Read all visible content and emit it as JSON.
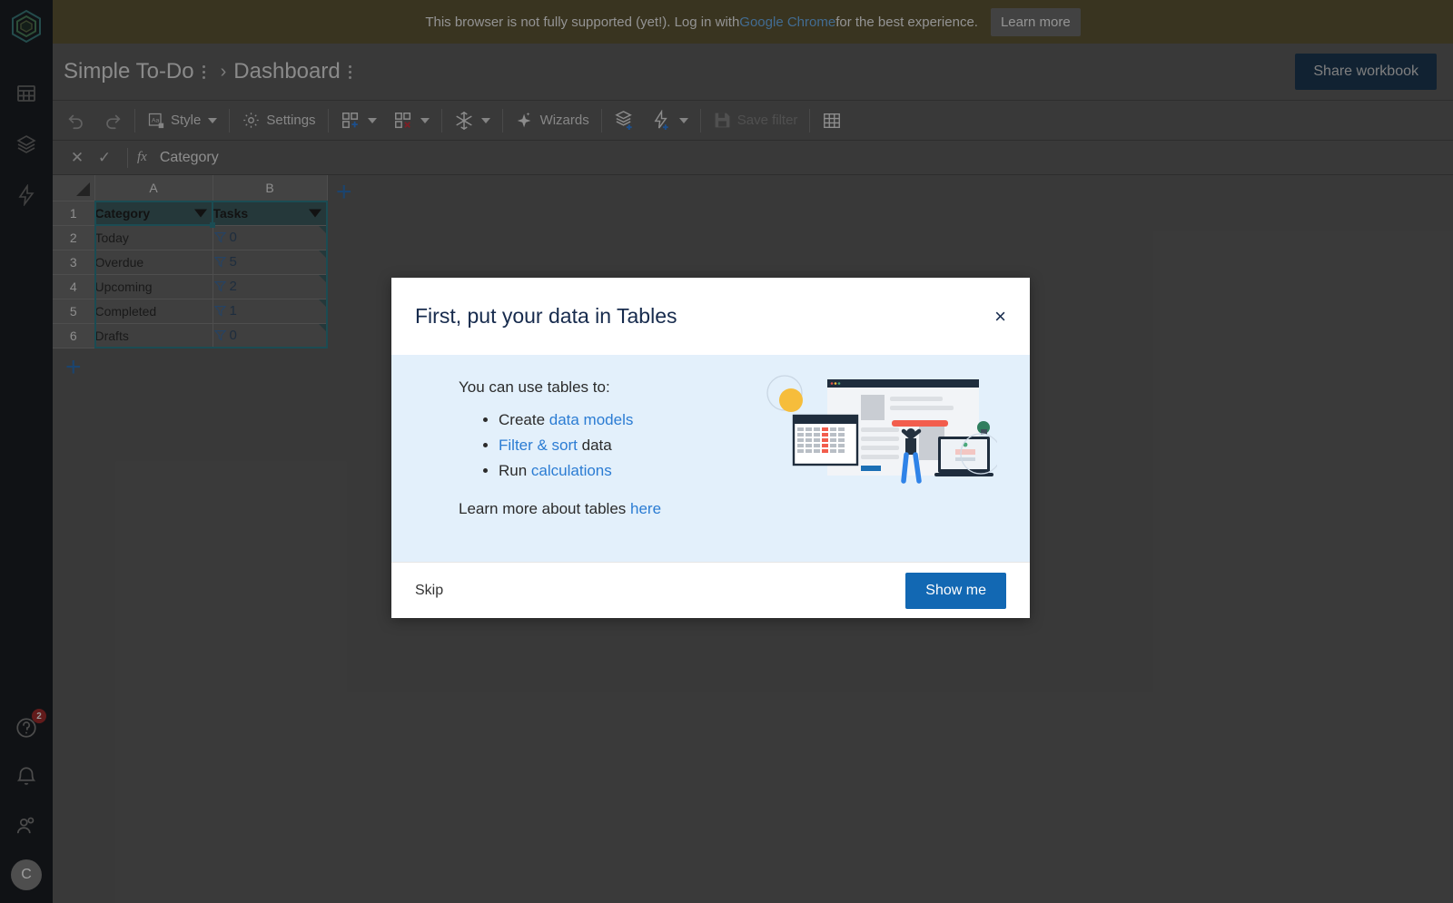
{
  "banner": {
    "text_before": "This browser is not fully supported (yet!). Log in with ",
    "link": "Google Chrome",
    "text_after": " for the best experience.",
    "button": "Learn more"
  },
  "header": {
    "workbook": "Simple To-Do",
    "sheet": "Dashboard",
    "share_label": "Share workbook"
  },
  "toolbar": {
    "undo": "undo-icon",
    "redo": "redo-icon",
    "style": "Style",
    "settings": "Settings",
    "add_table": "add-table-icon",
    "remove_table": "remove-table-icon",
    "freeze": "freeze-icon",
    "wizards": "Wizards",
    "add_layer": "add-layer-icon",
    "add_action": "add-action-icon",
    "save_filter": "Save filter",
    "grid_toggle": "grid-icon"
  },
  "formula_bar": {
    "cancel": "cancel-icon",
    "accept": "accept-icon",
    "fx": "fx",
    "value": "Category"
  },
  "grid": {
    "columns": [
      "A",
      "B"
    ],
    "rows": [
      "1",
      "2",
      "3",
      "4",
      "5",
      "6"
    ],
    "headers": [
      "Category",
      "Tasks"
    ],
    "data": [
      {
        "category": "Today",
        "tasks": "0"
      },
      {
        "category": "Overdue",
        "tasks": "5"
      },
      {
        "category": "Upcoming",
        "tasks": "2"
      },
      {
        "category": "Completed",
        "tasks": "1"
      },
      {
        "category": "Drafts",
        "tasks": "0"
      }
    ],
    "add_column": "+",
    "add_row": "+"
  },
  "sidebar": {
    "logo": "hexagon-logo",
    "items": [
      {
        "name": "grid-icon"
      },
      {
        "name": "layers-icon"
      },
      {
        "name": "bolt-icon"
      }
    ],
    "bottom": [
      {
        "name": "help-icon",
        "badge": "2"
      },
      {
        "name": "bell-icon",
        "badge": ""
      },
      {
        "name": "users-icon",
        "badge": ""
      }
    ],
    "avatar": "C"
  },
  "modal": {
    "title": "First, put your data in Tables",
    "close": "×",
    "lead": "You can use tables to:",
    "bullets": [
      {
        "pre": "Create ",
        "link": "data models",
        "post": ""
      },
      {
        "pre": "",
        "link": "Filter & sort",
        "post": " data"
      },
      {
        "pre": "Run ",
        "link": "calculations",
        "post": ""
      }
    ],
    "learn_text": "Learn more about tables ",
    "learn_link": "here",
    "skip": "Skip",
    "primary": "Show me"
  },
  "colors": {
    "banner_bg": "#4e4527",
    "chrome_bg": "#4e4e4e",
    "rail_bg": "#0e1116",
    "accent_blue": "#1268b3",
    "table_header": "#2f4c4f",
    "selection": "#1f6a75",
    "modal_body": "#e3f0fb"
  }
}
